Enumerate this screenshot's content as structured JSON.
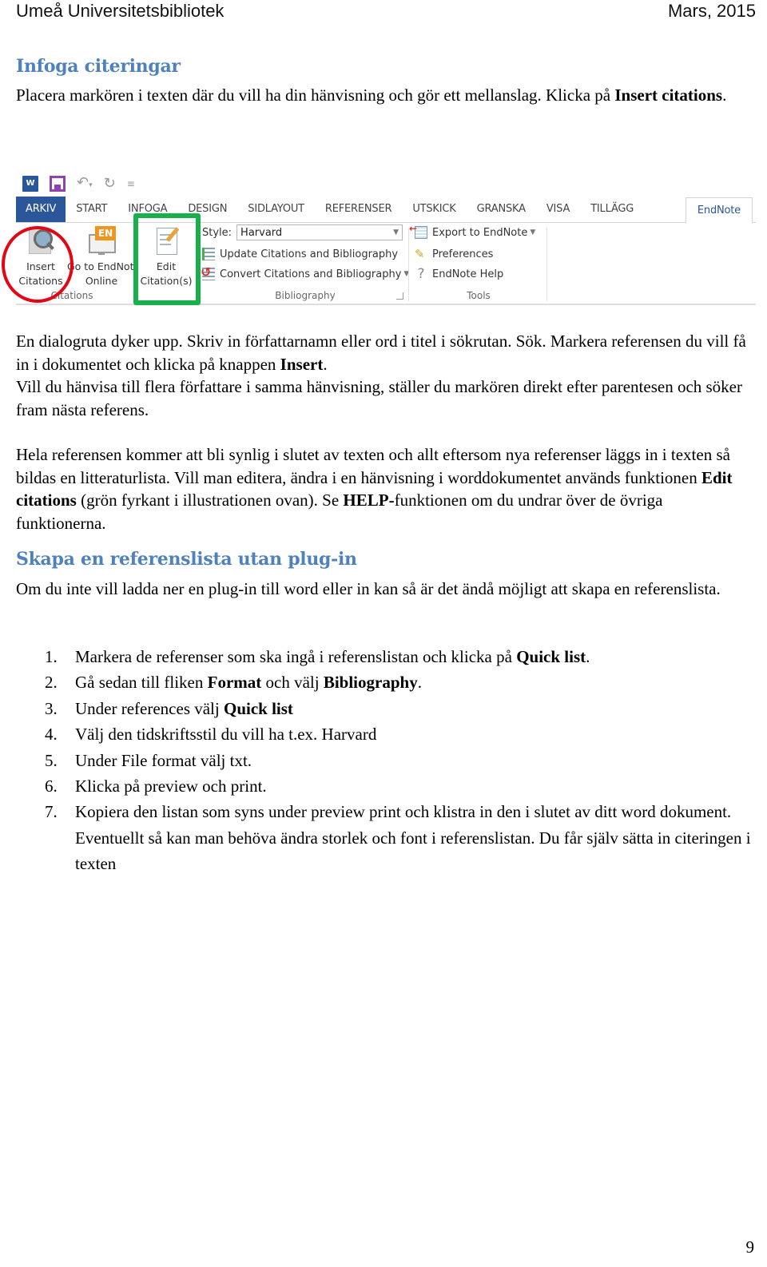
{
  "header": {
    "left": "Umeå Universitetsbibliotek",
    "right": "Mars, 2015"
  },
  "section1": {
    "heading": "Infoga citeringar",
    "intro": {
      "text": "Placera markören i texten där du vill ha din hänvisning och gör ett mellanslag. Klicka på ",
      "bold": "Insert citations",
      "end": "."
    }
  },
  "ribbon": {
    "quick_access": {
      "app_icon": "word-icon",
      "save_icon": "save-icon",
      "undo_icon": "undo-icon",
      "redo_icon": "redo-icon",
      "customize_icon": "customize-qat-icon"
    },
    "tabs": [
      {
        "label": "ARKIV"
      },
      {
        "label": "START"
      },
      {
        "label": "INFOGA"
      },
      {
        "label": "DESIGN"
      },
      {
        "label": "SIDLAYOUT"
      },
      {
        "label": "REFERENSER"
      },
      {
        "label": "UTSKICK"
      },
      {
        "label": "GRANSKA"
      },
      {
        "label": "VISA"
      },
      {
        "label": "TILLÄGG"
      },
      {
        "label": "EndNote"
      }
    ],
    "active_tab": "EndNote",
    "groups": {
      "citations": {
        "label": "Citations",
        "buttons": [
          {
            "line1": "Insert",
            "line2": "Citations"
          },
          {
            "line1": "Go to EndNote",
            "line2": "Online"
          },
          {
            "line1": "Edit",
            "line2": "Citation(s)"
          }
        ]
      },
      "bibliography": {
        "label": "Bibliography",
        "style_label": "Style:",
        "style_value": "Harvard",
        "update": "Update Citations and Bibliography",
        "convert": "Convert Citations and Bibliography"
      },
      "tools": {
        "label": "Tools",
        "export": "Export to EndNote",
        "preferences": "Preferences",
        "help": "EndNote Help"
      }
    },
    "annotation_colors": {
      "red_circle": "#e30613",
      "green_box": "#19b04b"
    }
  },
  "para_dialog": {
    "line1": "En dialogruta dyker upp. Skriv in författarnamn eller ord i titel i sökrutan. Sök. Markera referensen du vill få in i dokumentet och klicka på knappen ",
    "bold": "Insert",
    "end": ".",
    "line2": "Vill du hänvisa till flera författare i samma hänvisning, ställer du markören direkt efter parentesen och söker fram nästa referens."
  },
  "para_full": {
    "part1": "Hela referensen kommer att bli synlig i slutet av texten och allt eftersom nya referenser läggs in i texten så bildas en litteraturlista. Vill man editera, ändra i en hänvisning i worddokumentet används funktionen ",
    "bold1": "Edit citations",
    "part2": " (grön fyrkant i illustrationen ovan).  Se ",
    "bold2": "HELP-",
    "part3": "funktionen om du undrar över de övriga funktionerna."
  },
  "section2": {
    "heading": "Skapa en referenslista utan plug-in",
    "intro": "Om du inte vill ladda ner en plug-in till word eller in kan så är det ändå möjligt att skapa en referenslista."
  },
  "steps": [
    {
      "num": "1.",
      "a": "Markera de referenser som ska ingå i referenslistan och klicka på ",
      "b": "Quick list",
      "c": "."
    },
    {
      "num": "2.",
      "a": "Gå sedan till fliken ",
      "b": "Format",
      "c": " och välj ",
      "d": "Bibliography",
      "e": "."
    },
    {
      "num": "3.",
      "a": "Under references välj ",
      "b": "Quick list"
    },
    {
      "num": "4.",
      "a": "Välj den tidskriftsstil du vill ha t.ex. Harvard"
    },
    {
      "num": "5.",
      "a": "Under File format välj txt."
    },
    {
      "num": "6.",
      "a": "Klicka på preview och print."
    },
    {
      "num": "7.",
      "a": "Kopiera den listan som syns under preview print och klistra in den i slutet av ditt word dokument. Eventuellt så kan man behöva ändra storlek och font i referenslistan. Du får själv sätta in citeringen i texten"
    }
  ],
  "footer": {
    "page_number": "9"
  }
}
